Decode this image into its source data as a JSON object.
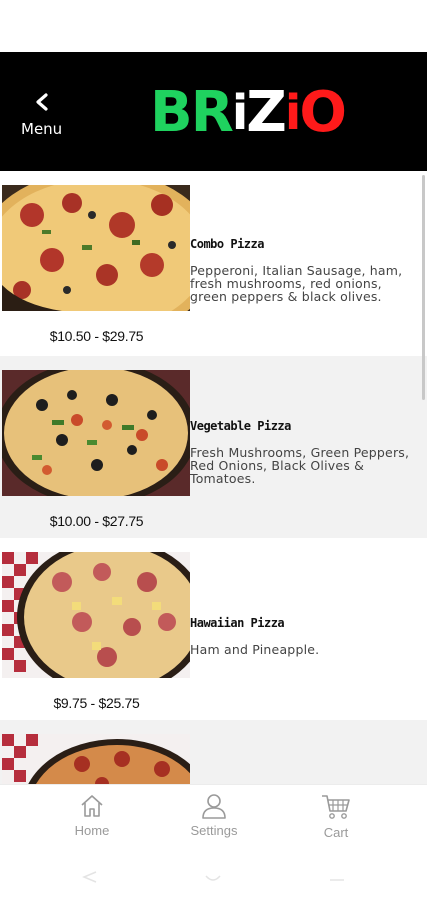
{
  "header": {
    "back_label": "Menu",
    "logo_letters": [
      {
        "char": "B",
        "color": "#1fd25f"
      },
      {
        "char": "R",
        "color": "#1fd25f"
      },
      {
        "char": "i",
        "color": "#ffffff"
      },
      {
        "char": "Z",
        "color": "#ffffff"
      },
      {
        "char": "i",
        "color": "#ff1a1a"
      },
      {
        "char": "O",
        "color": "#ff1a1a"
      }
    ]
  },
  "menu_items": [
    {
      "name": "Combo Pizza",
      "description": "Pepperoni, Italian Sausage, ham, fresh mushrooms, red onions, green peppers & black olives.",
      "price": "$10.50 - $29.75"
    },
    {
      "name": "Vegetable Pizza",
      "description": "Fresh Mushrooms, Green Peppers, Red Onions, Black Olives & Tomatoes.",
      "price": "$10.00 - $27.75"
    },
    {
      "name": "Hawaiian Pizza",
      "description": "Ham and Pineapple.",
      "price": "$9.75 - $25.75"
    }
  ],
  "tabs": [
    {
      "label": "Home",
      "icon": "home-icon"
    },
    {
      "label": "Settings",
      "icon": "person-icon"
    },
    {
      "label": "Cart",
      "icon": "cart-icon"
    }
  ],
  "colors": {
    "header_bg": "#000000",
    "alt_row_bg": "#f2f2f2",
    "tab_label": "#9a9a9a",
    "logo_green": "#1fd25f",
    "logo_red": "#ff1a1a"
  }
}
